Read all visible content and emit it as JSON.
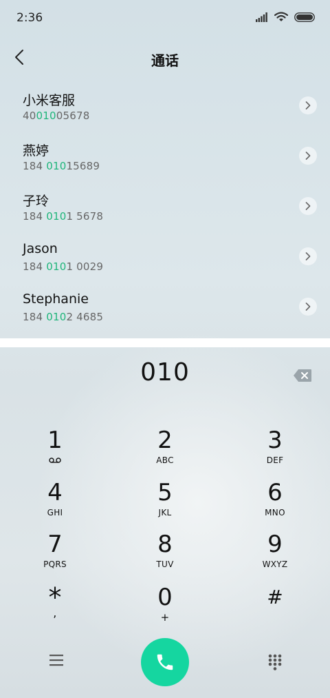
{
  "status_bar": {
    "time": "2:36"
  },
  "header": {
    "title": "通话"
  },
  "contacts": [
    {
      "name": "小米客服",
      "number_pre": "40",
      "number_match": "010",
      "number_post": "05678"
    },
    {
      "name": "燕婷",
      "number_pre": "184 ",
      "number_match": "010",
      "number_post": "15689"
    },
    {
      "name": "子玲",
      "number_pre": "184 ",
      "number_match": "010",
      "number_post": "1 5678"
    },
    {
      "name": "Jason",
      "number_pre": "184 ",
      "number_match": "010",
      "number_post": "1 0029"
    },
    {
      "name": "Stephanie",
      "number_pre": "184 ",
      "number_match": "010",
      "number_post": "2 4685"
    }
  ],
  "dialer": {
    "entered_number": "010"
  },
  "keypad": [
    {
      "digit": "1",
      "letters": ""
    },
    {
      "digit": "2",
      "letters": "ABC"
    },
    {
      "digit": "3",
      "letters": "DEF"
    },
    {
      "digit": "4",
      "letters": "GHI"
    },
    {
      "digit": "5",
      "letters": "JKL"
    },
    {
      "digit": "6",
      "letters": "MNO"
    },
    {
      "digit": "7",
      "letters": "PQRS"
    },
    {
      "digit": "8",
      "letters": "TUV"
    },
    {
      "digit": "9",
      "letters": "WXYZ"
    },
    {
      "digit": "*",
      "letters": ","
    },
    {
      "digit": "0",
      "letters": "+"
    },
    {
      "digit": "#",
      "letters": ""
    }
  ],
  "icons": {
    "back": "chevron-left-icon",
    "backspace": "backspace-icon",
    "voicemail": "voicemail-icon",
    "menu": "menu-icon",
    "call": "phone-icon",
    "keypad_toggle": "dialpad-icon"
  },
  "colors": {
    "match_highlight": "#1fb57a",
    "call_button": "#15d6a0"
  }
}
